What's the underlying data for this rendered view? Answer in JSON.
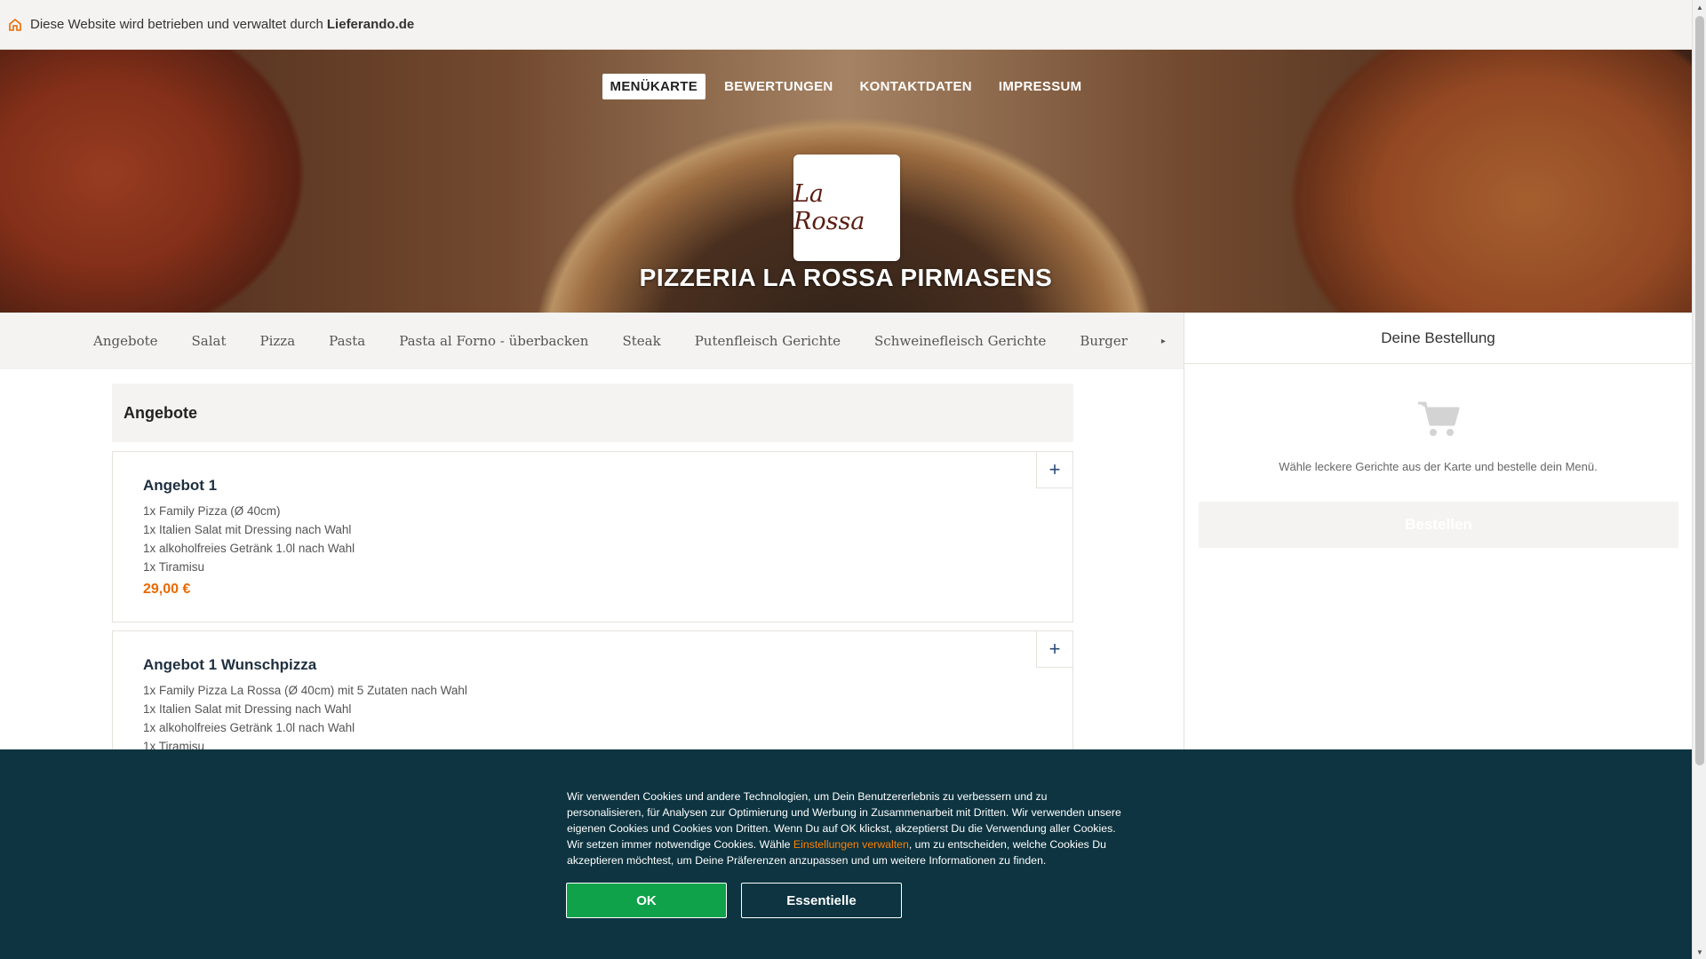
{
  "operator_bar": {
    "text": "Diese Website wird betrieben und verwaltet durch",
    "brand": "Lieferando.de",
    "icon": "home-icon"
  },
  "nav": {
    "items": [
      {
        "label": "MENÜKARTE",
        "active": true
      },
      {
        "label": "BEWERTUNGEN",
        "active": false
      },
      {
        "label": "KONTAKTDATEN",
        "active": false
      },
      {
        "label": "IMPRESSUM",
        "active": false
      }
    ]
  },
  "restaurant": {
    "logo_text": "La Rossa",
    "name": "PIZZERIA LA ROSSA PIRMASENS"
  },
  "categories": {
    "items": [
      "Angebote",
      "Salat",
      "Pizza",
      "Pasta",
      "Pasta al Forno - überbacken",
      "Steak",
      "Putenfleisch Gerichte",
      "Schweinefleisch Gerichte",
      "Burger"
    ],
    "more_icon": "chevron-more-icon"
  },
  "menu": {
    "section_title": "Angebote",
    "meals": [
      {
        "name": "Angebot 1",
        "description": [
          "1x Family Pizza (Ø 40cm)",
          "1x Italien Salat mit Dressing nach Wahl",
          "1x alkoholfreies Getränk 1.0l nach Wahl",
          "1x Tiramisu"
        ],
        "price": "29,00 €",
        "add_label": "+"
      },
      {
        "name": "Angebot 1 Wunschpizza",
        "description": [
          "1x Family Pizza La Rossa (Ø 40cm) mit 5 Zutaten nach Wahl",
          "1x Italien Salat mit Dressing nach Wahl",
          "1x alkoholfreies Getränk 1.0l nach Wahl",
          "1x Tiramisu"
        ],
        "add_label": "+"
      }
    ]
  },
  "basket": {
    "title": "Deine Bestellung",
    "empty_text": "Wähle leckere Gerichte aus der Karte und bestelle dein Menü.",
    "order_button": "Bestellen",
    "icon": "shopping-cart-icon"
  },
  "cookie": {
    "text_before_link": "Wir verwenden Cookies und andere Technologien, um Dein Benutzererlebnis zu verbessern und zu personalisieren, für Analysen zur Optimierung und Werbung in Zusammenarbeit mit Dritten. Wir verwenden unsere eigenen Cookies und Cookies von Dritten. Wenn Du auf OK klickst, akzeptierst Du die Verwendung aller Cookies. Wir setzen immer notwendige Cookies. Wähle ",
    "link": "Einstellungen verwalten",
    "text_after_link": ", um zu entscheiden, welche Cookies Du akzeptieren möchtest, um Deine Präferenzen anzupassen und um weitere Informationen zu finden.",
    "ok_button": "OK",
    "essential_button": "Essentielle"
  },
  "colors": {
    "accent_orange": "#e96a00",
    "banner_bg": "#0d3440",
    "ok_green": "#0fa24a"
  }
}
